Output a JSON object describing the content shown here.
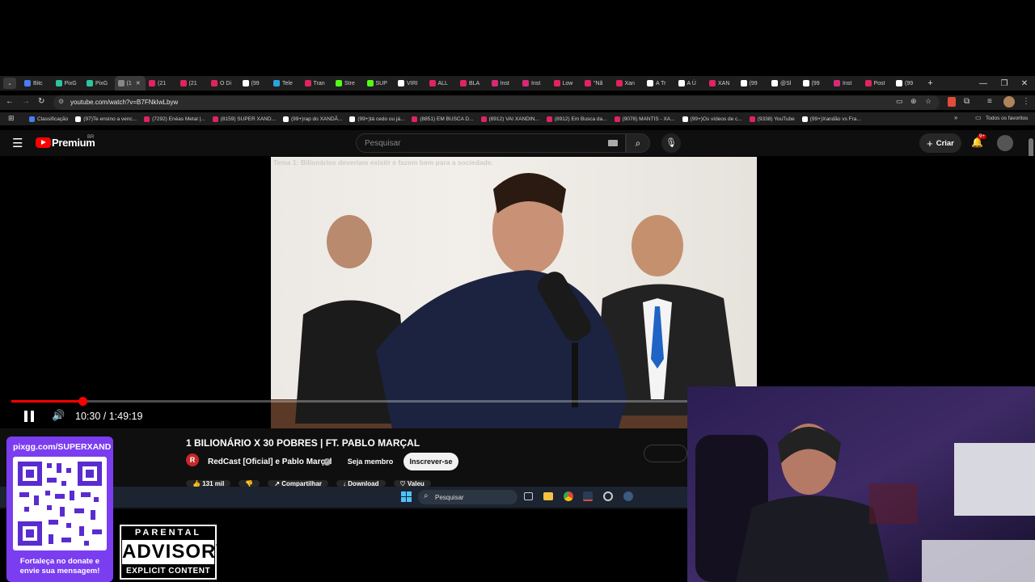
{
  "browser": {
    "tabs": [
      {
        "label": "Bitc",
        "color": "#4a7ef0"
      },
      {
        "label": "PixG",
        "color": "#2ec4a0"
      },
      {
        "label": "PixG",
        "color": "#2ec4a0"
      },
      {
        "label": "(1",
        "color": "#888888",
        "active": true
      },
      {
        "label": "(21",
        "color": "#e0245e"
      },
      {
        "label": "(21",
        "color": "#e0245e"
      },
      {
        "label": "O Di",
        "color": "#e0245e"
      },
      {
        "label": "(99",
        "color": "#ffffff"
      },
      {
        "label": "Tele",
        "color": "#2aa3e0"
      },
      {
        "label": "Tran",
        "color": "#e0245e"
      },
      {
        "label": "Stre",
        "color": "#53fc18"
      },
      {
        "label": "SUP",
        "color": "#53fc18"
      },
      {
        "label": "VIRI",
        "color": "#ffffff"
      },
      {
        "label": "ALL",
        "color": "#e0245e"
      },
      {
        "label": "BLA",
        "color": "#e0245e"
      },
      {
        "label": "Inst",
        "color": "#d62976"
      },
      {
        "label": "Inst",
        "color": "#d62976"
      },
      {
        "label": "Low",
        "color": "#e0245e"
      },
      {
        "label": "\"Nã",
        "color": "#e0245e"
      },
      {
        "label": "Xan",
        "color": "#e0245e"
      },
      {
        "label": "A Tr",
        "color": "#ffffff"
      },
      {
        "label": "A Ú",
        "color": "#ffffff"
      },
      {
        "label": "XAN",
        "color": "#e0245e"
      },
      {
        "label": "(99",
        "color": "#ffffff"
      },
      {
        "label": "@Sl",
        "color": "#ffffff"
      },
      {
        "label": "(99",
        "color": "#ffffff"
      },
      {
        "label": "Inst",
        "color": "#d62976"
      },
      {
        "label": "Post",
        "color": "#e0245e"
      },
      {
        "label": "(99",
        "color": "#ffffff"
      }
    ],
    "url": "youtube.com/watch?v=B7FNkIwLbyw",
    "bookmarks": [
      {
        "label": "Classificação",
        "color": "#4a7ef0"
      },
      {
        "label": "(97)Te ensino a venc...",
        "color": "#ffffff"
      },
      {
        "label": "(7292) Enéas Metal |...",
        "color": "#e0245e"
      },
      {
        "label": "(8159) SUPER XAND...",
        "color": "#e0245e"
      },
      {
        "label": "(99+)rap do XANDÃ...",
        "color": "#ffffff"
      },
      {
        "label": "(99+)tá cedo ou já...",
        "color": "#ffffff"
      },
      {
        "label": "(8851) EM BUSCA D...",
        "color": "#e0245e"
      },
      {
        "label": "(8912) VAI XANDIN...",
        "color": "#e0245e"
      },
      {
        "label": "(8912) Em Busca da...",
        "color": "#e0245e"
      },
      {
        "label": "(9078) MANTIS - XA...",
        "color": "#e0245e"
      },
      {
        "label": "(99+)Os vídeos de c...",
        "color": "#ffffff"
      },
      {
        "label": "(9338) YouTube",
        "color": "#e0245e"
      },
      {
        "label": "(99+)Xandão vs Fra...",
        "color": "#ffffff"
      }
    ],
    "all_bookmarks": "Todos os favoritos"
  },
  "youtube": {
    "logo_text": "Premium",
    "region": "BR",
    "search_placeholder": "Pesquisar",
    "create_label": "Criar",
    "notifications": "9+",
    "overlay_text": "Tema 1: Bilionários deveriam existir e fazem bem para a sociedade.",
    "time_current": "10:30",
    "time_total": "1:49:19",
    "time_separator": "/",
    "progress_fraction": 0.096,
    "title": "1 BILIONÁRIO X 30 POBRES | FT. PABLO MARÇAL",
    "channel": "RedCast [Oficial] e Pablo Marçal",
    "member_label": "Seja membro",
    "subscribe_label": "Inscrever-se",
    "likes": "131 mil",
    "share_label": "Compartilhar",
    "download_label": "Download",
    "valeu_label": "Valeu"
  },
  "taskbar": {
    "search_label": "Pesquisar"
  },
  "overlay": {
    "qr_url": "pixgg.com/SUPERXAND",
    "qr_message": "Fortaleça no donate e envie sua mensagem!",
    "advisory_top": "PARENTAL",
    "advisory_mid": "ADVISORY",
    "advisory_bottom": "EXPLICIT CONTENT"
  }
}
